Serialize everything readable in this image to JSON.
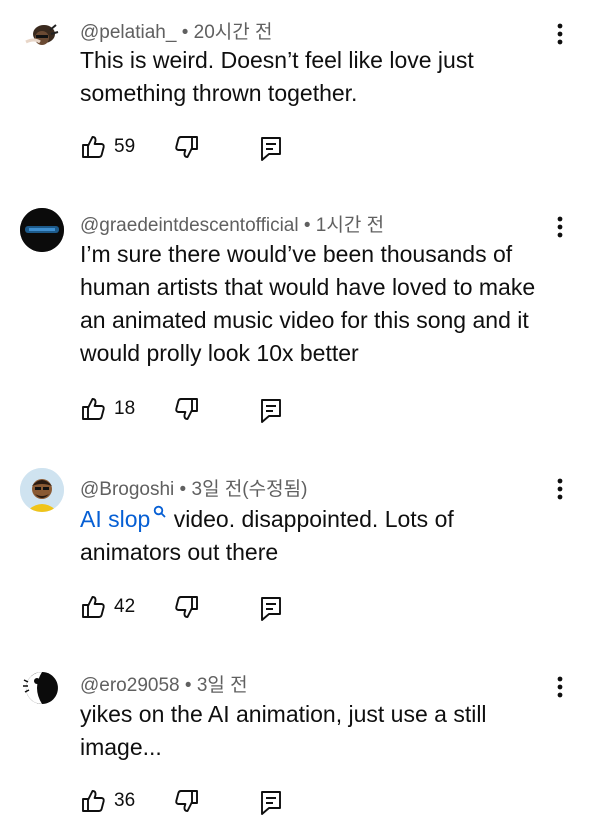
{
  "comments": [
    {
      "handle": "@pelatiah_",
      "time": "20시간 전",
      "text": "This is weird. Doesn’t feel like love just something thrown together.",
      "likes": "59"
    },
    {
      "handle": "@graedeintdescentofficial",
      "time": "1시간 전",
      "text": "I’m sure there would’ve been thousands of human artists that would have loved to make an animated music video for this song and it would prolly look 10x better",
      "likes": "18"
    },
    {
      "handle": "@Brogoshi",
      "time": "3일 전(수정됨)",
      "link_text": "AI slop",
      "text_after_link": " video. disappointed. Lots of animators out there",
      "likes": "42"
    },
    {
      "handle": "@ero29058",
      "time": "3일 전",
      "text": "yikes on the AI animation,  just use a still image...",
      "likes": "36"
    }
  ],
  "separator": " • ",
  "icons": {
    "like": "thumbs-up-icon",
    "dislike": "thumbs-down-icon",
    "reply": "reply-icon",
    "menu": "more-vert-icon",
    "search": "search-icon"
  },
  "colors": {
    "link": "#065fd4",
    "meta": "#606060",
    "text": "#0f0f0f"
  }
}
